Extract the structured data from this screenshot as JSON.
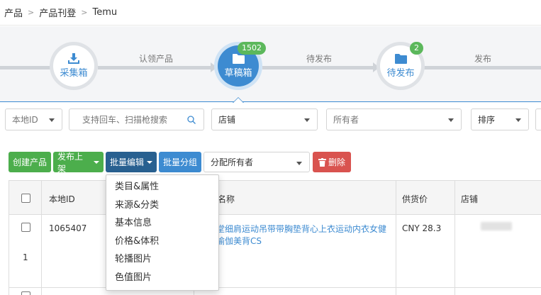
{
  "breadcrumb": {
    "items": [
      "产品",
      "产品刊登",
      "Temu"
    ]
  },
  "workflow": {
    "nodes": [
      {
        "label": "采集箱",
        "icon": "download-icon",
        "badge": ""
      },
      {
        "label": "草稿箱",
        "icon": "folder-icon",
        "badge": "1502"
      },
      {
        "label": "待发布",
        "icon": "folder-icon",
        "badge": "2"
      }
    ],
    "steps": [
      "认领产品",
      "待发布",
      "发布"
    ]
  },
  "filters": {
    "local_id": "本地ID",
    "search_placeholder": "支持回车、扫描枪搜索",
    "store": "店铺",
    "owner_placeholder": "所有者",
    "sort": "排序"
  },
  "toolbar": {
    "create": "创建产品",
    "publish": "发布上架",
    "batch_edit": "批量编辑",
    "batch_group": "批量分组",
    "assign_owner": "分配所有者",
    "delete": "删除"
  },
  "table": {
    "headers": [
      "本地ID",
      "名称",
      "供货价",
      "店铺"
    ],
    "rows": [
      {
        "index": "1",
        "local_id": "1065407",
        "name": "衣堂细肩运动吊带带胸垫背心上衣运动内衣女健身瑜伽美背CS",
        "price": "CNY 28.3",
        "store": ""
      }
    ]
  },
  "batch_edit_menu": {
    "items": [
      "类目&属性",
      "来源&分类",
      "基本信息",
      "价格&体积",
      "轮播图片",
      "色值图片"
    ]
  },
  "colors": {
    "primary": "#3d8bd1",
    "success": "#4cae4c",
    "danger": "#d9534f",
    "badge": "#5cb85c"
  }
}
